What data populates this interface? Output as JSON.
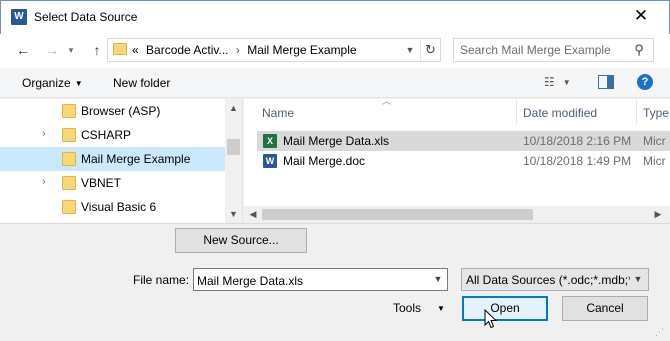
{
  "window": {
    "title": "Select Data Source",
    "app_icon_letter": "W",
    "close_glyph": "✕"
  },
  "addressbar": {
    "overflow": "«",
    "segments": [
      "Barcode Activ...",
      "Mail Merge Example"
    ],
    "separator": "›"
  },
  "search": {
    "placeholder": "Search Mail Merge Example"
  },
  "toolbar": {
    "organize_label": "Organize",
    "new_folder_label": "New folder",
    "help_glyph": "?"
  },
  "nav": {
    "items": [
      {
        "label": "Browser (ASP)",
        "expandable": false,
        "selected": false
      },
      {
        "label": "CSHARP",
        "expandable": true,
        "selected": false
      },
      {
        "label": "Mail Merge Example",
        "expandable": false,
        "selected": true
      },
      {
        "label": "VBNET",
        "expandable": true,
        "selected": false
      },
      {
        "label": "Visual Basic 6",
        "expandable": false,
        "selected": false
      }
    ]
  },
  "files": {
    "columns": {
      "name": "Name",
      "date": "Date modified",
      "type": "Type"
    },
    "rows": [
      {
        "name": "Mail Merge Data.xls",
        "date": "10/18/2018 2:16 PM",
        "type": "Micr",
        "icon": "excel-file-icon",
        "icon_letter": "X",
        "selected": true
      },
      {
        "name": "Mail Merge.doc",
        "date": "10/18/2018 1:49 PM",
        "type": "Micr",
        "icon": "word-file-icon",
        "icon_letter": "W",
        "selected": false
      }
    ]
  },
  "bottom": {
    "new_source_label": "New Source...",
    "file_name_label": "File name:",
    "file_name_value": "Mail Merge Data.xls",
    "file_type_value": "All Data Sources (*.odc;*.mdb;*",
    "tools_label": "Tools",
    "open_label": "Open",
    "cancel_label": "Cancel"
  },
  "colors": {
    "accent": "#0078d7",
    "selection": "#cce8ff",
    "folder": "#f8d775",
    "word": "#2b579a",
    "excel": "#1f7244"
  }
}
